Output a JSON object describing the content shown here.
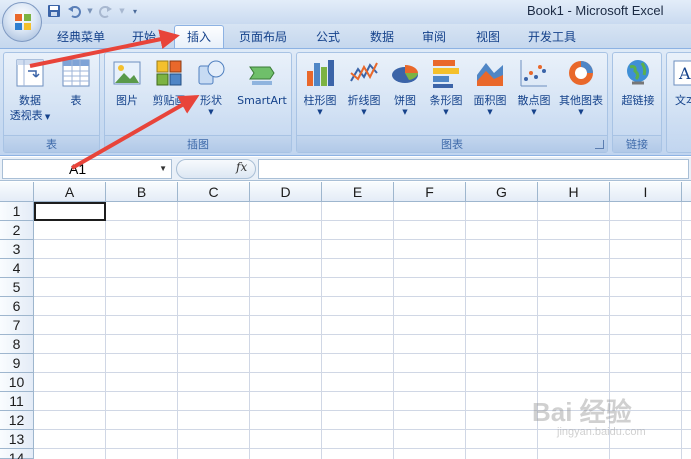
{
  "window": {
    "title": "Book1 - Microsoft Excel"
  },
  "tabs": [
    {
      "label": "经典菜单"
    },
    {
      "label": "开始"
    },
    {
      "label": "插入"
    },
    {
      "label": "页面布局"
    },
    {
      "label": "公式"
    },
    {
      "label": "数据"
    },
    {
      "label": "审阅"
    },
    {
      "label": "视图"
    },
    {
      "label": "开发工具"
    }
  ],
  "active_tab": "插入",
  "groups": {
    "table": {
      "label": "表",
      "pivot_label": "数据\n透视表",
      "pivot_line1": "数据",
      "pivot_line2": "透视表",
      "table_label": "表"
    },
    "illustrations": {
      "label": "插图",
      "picture": "图片",
      "clipart": "剪贴画",
      "shapes": "形状",
      "smartart": "SmartArt"
    },
    "charts": {
      "label": "图表",
      "column": "柱形图",
      "line": "折线图",
      "pie": "饼图",
      "bar": "条形图",
      "area": "面积图",
      "scatter": "散点图",
      "other": "其他图表"
    },
    "links": {
      "label": "链接",
      "hyperlink": "超链接"
    },
    "text": {
      "label": "文本"
    }
  },
  "formula_bar": {
    "name_box": "A1",
    "fx_label": "fx",
    "formula": ""
  },
  "columns": [
    "A",
    "B",
    "C",
    "D",
    "E",
    "F",
    "G",
    "H",
    "I"
  ],
  "rows": [
    "1",
    "2",
    "3",
    "4",
    "5",
    "6",
    "7",
    "8",
    "9",
    "10",
    "11",
    "12",
    "13",
    "14"
  ],
  "watermark": {
    "text": "Bai 经验",
    "sub": "jingyan.baidu.com"
  },
  "colors": {
    "arrow": "#e8443a",
    "accent": "#15428b"
  }
}
